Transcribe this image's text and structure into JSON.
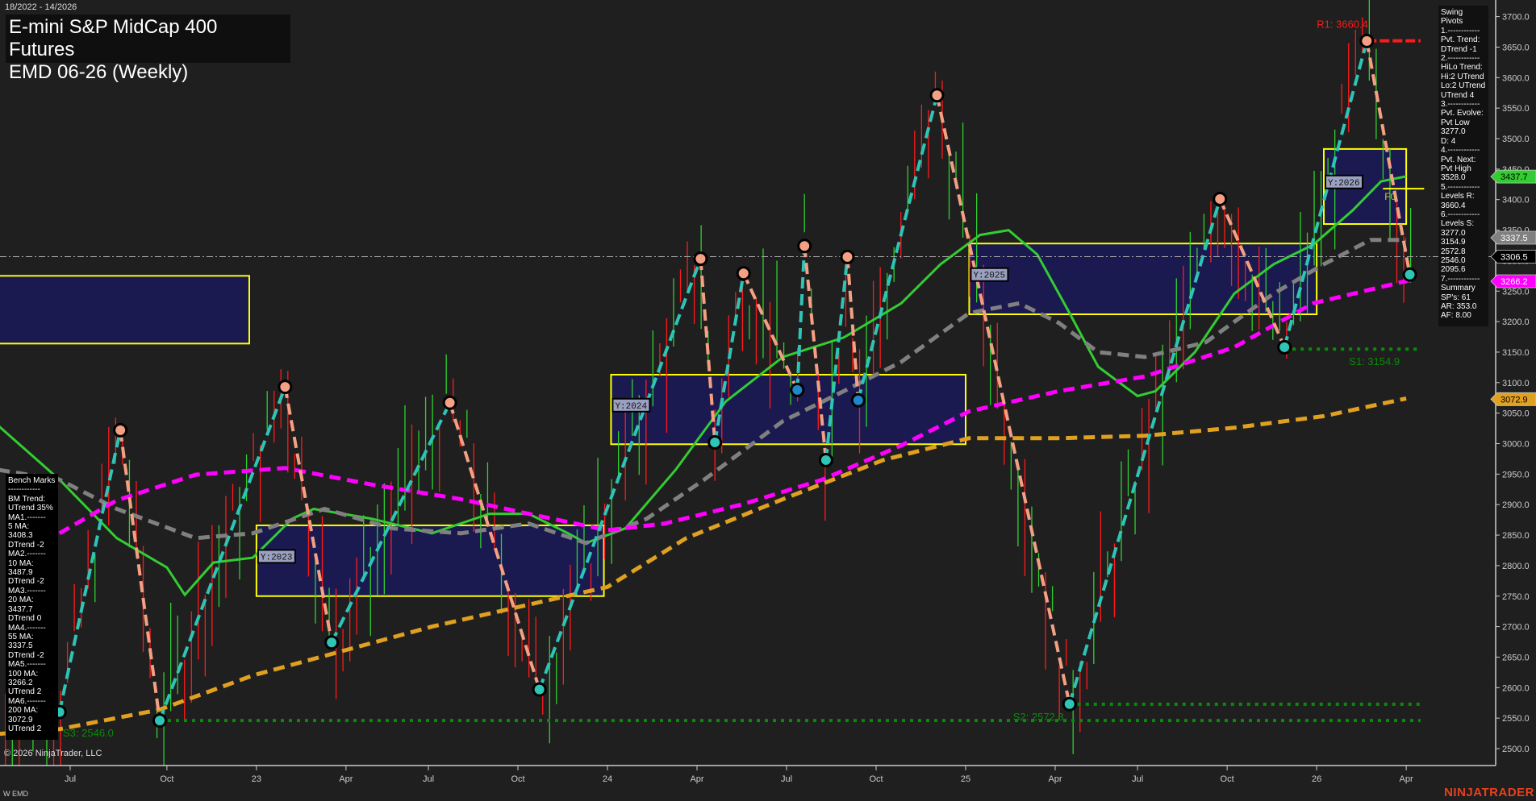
{
  "header": {
    "date_range": "18/2022 - 14/2026",
    "title_line1": "E-mini S&P MidCap 400 Futures",
    "title_line2": "EMD 06-26 (Weekly)"
  },
  "swing_panel": {
    "lines": [
      "Swing Pivots",
      "1.------------",
      "Pvt. Trend:",
      "DTrend -1",
      "2.------------",
      "HiLo Trend:",
      "Hi:2 UTrend",
      "Lo:2 UTrend",
      "UTrend 4",
      "3.------------",
      "Pvt. Evolve:",
      "Pvt Low",
      "3277.0",
      "D: 4",
      "4.------------",
      "Pvt. Next:",
      "Pvt High",
      "3528.0",
      "5.------------",
      "Levels R:",
      "3660.4",
      "6.------------",
      "Levels S:",
      "3277.0",
      "3154.9",
      "2572.8",
      "2546.0",
      "2095.6",
      "7.------------",
      "Summary",
      "SP's: 61",
      "AR: 353.0",
      "AF: 8.00"
    ]
  },
  "bench_panel": {
    "lines": [
      "Bench Marks",
      "------------",
      "BM Trend:",
      "UTrend 35%",
      "MA1.-------",
      "5 MA:",
      "3408.3",
      "DTrend -2",
      "MA2.-------",
      "10 MA:",
      "3487.9",
      "DTrend -2",
      "MA3.-------",
      "20 MA:",
      "3437.7",
      "DTrend 0",
      "MA4.-------",
      "55 MA:",
      "3337.5",
      "DTrend -2",
      "MA5.-------",
      "100 MA:",
      "3266.2",
      "UTrend 2",
      "MA6.-------",
      "200 MA:",
      "3072.9",
      "UTrend 2"
    ]
  },
  "footer": {
    "copyright": "© 2026 NinjaTrader, LLC",
    "symbol": "W EMD",
    "brand": "NINJATRADER"
  },
  "colors": {
    "bg": "#1f1f1f",
    "up": "#2ec4b6",
    "down": "#f4a083",
    "ma20": "#33cc33",
    "ma55": "#808080",
    "ma100": "#ff00ff",
    "ma200": "#e0a020",
    "box": "#1a1a55",
    "box_border": "#ffff00",
    "resist": "#ff1a1a",
    "support": "#0a8a0a"
  },
  "chart_data": {
    "type": "line",
    "title": "EMD 06-26 (Weekly)",
    "ylim": [
      2480,
      3720
    ],
    "xlim": [
      2022.3,
      2026.47
    ],
    "y_ticks": [
      2500,
      2550,
      2600,
      2650,
      2700,
      2750,
      2800,
      2850,
      2900,
      2950,
      3000,
      3050,
      3100,
      3150,
      3200,
      3250,
      3300,
      3350,
      3400,
      3450,
      3500,
      3550,
      3600,
      3650,
      3700
    ],
    "x_ticks": [
      {
        "t": 2022.5,
        "label": "Jul"
      },
      {
        "t": 2022.77,
        "label": "Oct"
      },
      {
        "t": 2023.02,
        "label": "23"
      },
      {
        "t": 2023.27,
        "label": "Apr"
      },
      {
        "t": 2023.5,
        "label": "Jul"
      },
      {
        "t": 2023.75,
        "label": "Oct"
      },
      {
        "t": 2024.0,
        "label": "24"
      },
      {
        "t": 2024.25,
        "label": "Apr"
      },
      {
        "t": 2024.5,
        "label": "Jul"
      },
      {
        "t": 2024.75,
        "label": "Oct"
      },
      {
        "t": 2025.0,
        "label": "25"
      },
      {
        "t": 2025.25,
        "label": "Apr"
      },
      {
        "t": 2025.48,
        "label": "Jul"
      },
      {
        "t": 2025.73,
        "label": "Oct"
      },
      {
        "t": 2025.98,
        "label": "26"
      },
      {
        "t": 2026.23,
        "label": "Apr"
      }
    ],
    "pivots": [
      {
        "t": 2022.47,
        "p": 2560,
        "type": "low"
      },
      {
        "t": 2022.64,
        "p": 3022,
        "type": "high"
      },
      {
        "t": 2022.75,
        "p": 2546,
        "type": "low"
      },
      {
        "t": 2023.1,
        "p": 3093,
        "type": "high"
      },
      {
        "t": 2023.23,
        "p": 2674,
        "type": "low"
      },
      {
        "t": 2023.56,
        "p": 3067,
        "type": "high"
      },
      {
        "t": 2023.81,
        "p": 2597,
        "type": "low"
      },
      {
        "t": 2024.26,
        "p": 3303,
        "type": "high"
      },
      {
        "t": 2024.3,
        "p": 3002,
        "type": "low"
      },
      {
        "t": 2024.38,
        "p": 3279,
        "type": "high"
      },
      {
        "t": 2024.53,
        "p": 3088,
        "type": "low2"
      },
      {
        "t": 2024.55,
        "p": 3324,
        "type": "high"
      },
      {
        "t": 2024.61,
        "p": 2973,
        "type": "low"
      },
      {
        "t": 2024.67,
        "p": 3306,
        "type": "high"
      },
      {
        "t": 2024.7,
        "p": 3071,
        "type": "low2"
      },
      {
        "t": 2024.92,
        "p": 3571,
        "type": "high"
      },
      {
        "t": 2025.29,
        "p": 2573,
        "type": "low"
      },
      {
        "t": 2025.71,
        "p": 3401,
        "type": "high"
      },
      {
        "t": 2025.89,
        "p": 3158,
        "type": "low"
      },
      {
        "t": 2026.12,
        "p": 3660,
        "type": "high"
      },
      {
        "t": 2026.24,
        "p": 3277,
        "type": "low"
      }
    ],
    "series": [
      {
        "name": "20 MA",
        "color": "#33cc33",
        "style": "solid",
        "points": [
          [
            2022.3,
            3029
          ],
          [
            2022.47,
            2941
          ],
          [
            2022.63,
            2845
          ],
          [
            2022.77,
            2797
          ],
          [
            2022.82,
            2752
          ],
          [
            2022.9,
            2805
          ],
          [
            2023.01,
            2813
          ],
          [
            2023.12,
            2877
          ],
          [
            2023.18,
            2893
          ],
          [
            2023.34,
            2877
          ],
          [
            2023.51,
            2853
          ],
          [
            2023.67,
            2885
          ],
          [
            2023.78,
            2885
          ],
          [
            2023.89,
            2853
          ],
          [
            2023.94,
            2837
          ],
          [
            2024.05,
            2861
          ],
          [
            2024.19,
            2957
          ],
          [
            2024.33,
            3069
          ],
          [
            2024.49,
            3142
          ],
          [
            2024.66,
            3174
          ],
          [
            2024.82,
            3230
          ],
          [
            2024.93,
            3294
          ],
          [
            2025.04,
            3342
          ],
          [
            2025.12,
            3350
          ],
          [
            2025.2,
            3310
          ],
          [
            2025.29,
            3214
          ],
          [
            2025.37,
            3126
          ],
          [
            2025.48,
            3078
          ],
          [
            2025.53,
            3086
          ],
          [
            2025.64,
            3150
          ],
          [
            2025.75,
            3246
          ],
          [
            2025.86,
            3294
          ],
          [
            2025.97,
            3326
          ],
          [
            2026.08,
            3382
          ],
          [
            2026.16,
            3430
          ],
          [
            2026.23,
            3438
          ]
        ]
      },
      {
        "name": "55 MA",
        "color": "#808080",
        "style": "dash",
        "points": [
          [
            2022.3,
            2957
          ],
          [
            2022.47,
            2941
          ],
          [
            2022.63,
            2893
          ],
          [
            2022.85,
            2845
          ],
          [
            2023.01,
            2853
          ],
          [
            2023.21,
            2893
          ],
          [
            2023.4,
            2861
          ],
          [
            2023.59,
            2853
          ],
          [
            2023.78,
            2869
          ],
          [
            2023.94,
            2837
          ],
          [
            2024.11,
            2877
          ],
          [
            2024.27,
            2941
          ],
          [
            2024.49,
            3037
          ],
          [
            2024.66,
            3086
          ],
          [
            2024.82,
            3134
          ],
          [
            2025.01,
            3214
          ],
          [
            2025.15,
            3230
          ],
          [
            2025.26,
            3198
          ],
          [
            2025.37,
            3150
          ],
          [
            2025.5,
            3142
          ],
          [
            2025.67,
            3166
          ],
          [
            2025.86,
            3246
          ],
          [
            2026.0,
            3294
          ],
          [
            2026.13,
            3334
          ],
          [
            2026.23,
            3334
          ]
        ]
      },
      {
        "name": "100 MA",
        "color": "#ff00ff",
        "style": "dash",
        "points": [
          [
            2022.47,
            2853
          ],
          [
            2022.63,
            2907
          ],
          [
            2022.85,
            2949
          ],
          [
            2023.1,
            2960
          ],
          [
            2023.34,
            2933
          ],
          [
            2023.59,
            2909
          ],
          [
            2023.78,
            2885
          ],
          [
            2024.0,
            2858
          ],
          [
            2024.16,
            2869
          ],
          [
            2024.38,
            2901
          ],
          [
            2024.6,
            2941
          ],
          [
            2024.82,
            2997
          ],
          [
            2025.01,
            3053
          ],
          [
            2025.26,
            3086
          ],
          [
            2025.5,
            3110
          ],
          [
            2025.75,
            3158
          ],
          [
            2025.97,
            3230
          ],
          [
            2026.24,
            3268
          ]
        ]
      },
      {
        "name": "200 MA",
        "color": "#e0a020",
        "style": "dash",
        "points": [
          [
            2022.3,
            2524
          ],
          [
            2022.47,
            2532
          ],
          [
            2022.75,
            2564
          ],
          [
            2023.01,
            2620
          ],
          [
            2023.26,
            2660
          ],
          [
            2023.51,
            2700
          ],
          [
            2023.81,
            2740
          ],
          [
            2024.0,
            2765
          ],
          [
            2024.22,
            2845
          ],
          [
            2024.49,
            2909
          ],
          [
            2024.77,
            2973
          ],
          [
            2025.01,
            3009
          ],
          [
            2025.27,
            3009
          ],
          [
            2025.5,
            3013
          ],
          [
            2025.75,
            3026
          ],
          [
            2026.0,
            3045
          ],
          [
            2026.23,
            3074
          ]
        ]
      }
    ],
    "year_boxes": [
      {
        "label": "",
        "t0": 2022.2,
        "t1": 2023.0,
        "top": 3275,
        "bottom": 3164
      },
      {
        "label": "Y:2023",
        "t0": 2023.02,
        "t1": 2023.99,
        "top": 2866,
        "bottom": 2750
      },
      {
        "label": "Y:2024",
        "t0": 2024.01,
        "t1": 2025.0,
        "top": 3113,
        "bottom": 2999
      },
      {
        "label": "Y:2025",
        "t0": 2025.01,
        "t1": 2025.98,
        "top": 3328,
        "bottom": 3212
      },
      {
        "label": "Y:2026",
        "t0": 2026.0,
        "t1": 2026.23,
        "top": 3483,
        "bottom": 3360
      }
    ],
    "fib_label": {
      "label": "F0",
      "p": 3418
    },
    "levels": [
      {
        "label": "R1: 3660.4",
        "value": 3660.4,
        "t0": 2026.12,
        "kind": "resist"
      },
      {
        "label": "S1: 3154.9",
        "value": 3154.9,
        "t0": 2025.89,
        "kind": "support"
      },
      {
        "label": "S2: 2572.8",
        "value": 2572.8,
        "t0": 2025.29,
        "kind": "support"
      },
      {
        "label": "S3: 2546.0",
        "value": 2546.0,
        "t0": 2022.75,
        "kind": "support"
      }
    ],
    "last_price": 3306.5,
    "price_tags": [
      {
        "label": "3437.7",
        "value": 3437.7,
        "bg": "#33cc33",
        "fg": "#000"
      },
      {
        "label": "3337.5",
        "value": 3337.5,
        "bg": "#808080",
        "fg": "#fff"
      },
      {
        "label": "3306.5",
        "value": 3306.5,
        "bg": "#000000",
        "fg": "#fff"
      },
      {
        "label": "3266.2",
        "value": 3266.2,
        "bg": "#ff00ff",
        "fg": "#fff"
      },
      {
        "label": "3072.9",
        "value": 3072.9,
        "bg": "#e0a020",
        "fg": "#000"
      }
    ]
  }
}
